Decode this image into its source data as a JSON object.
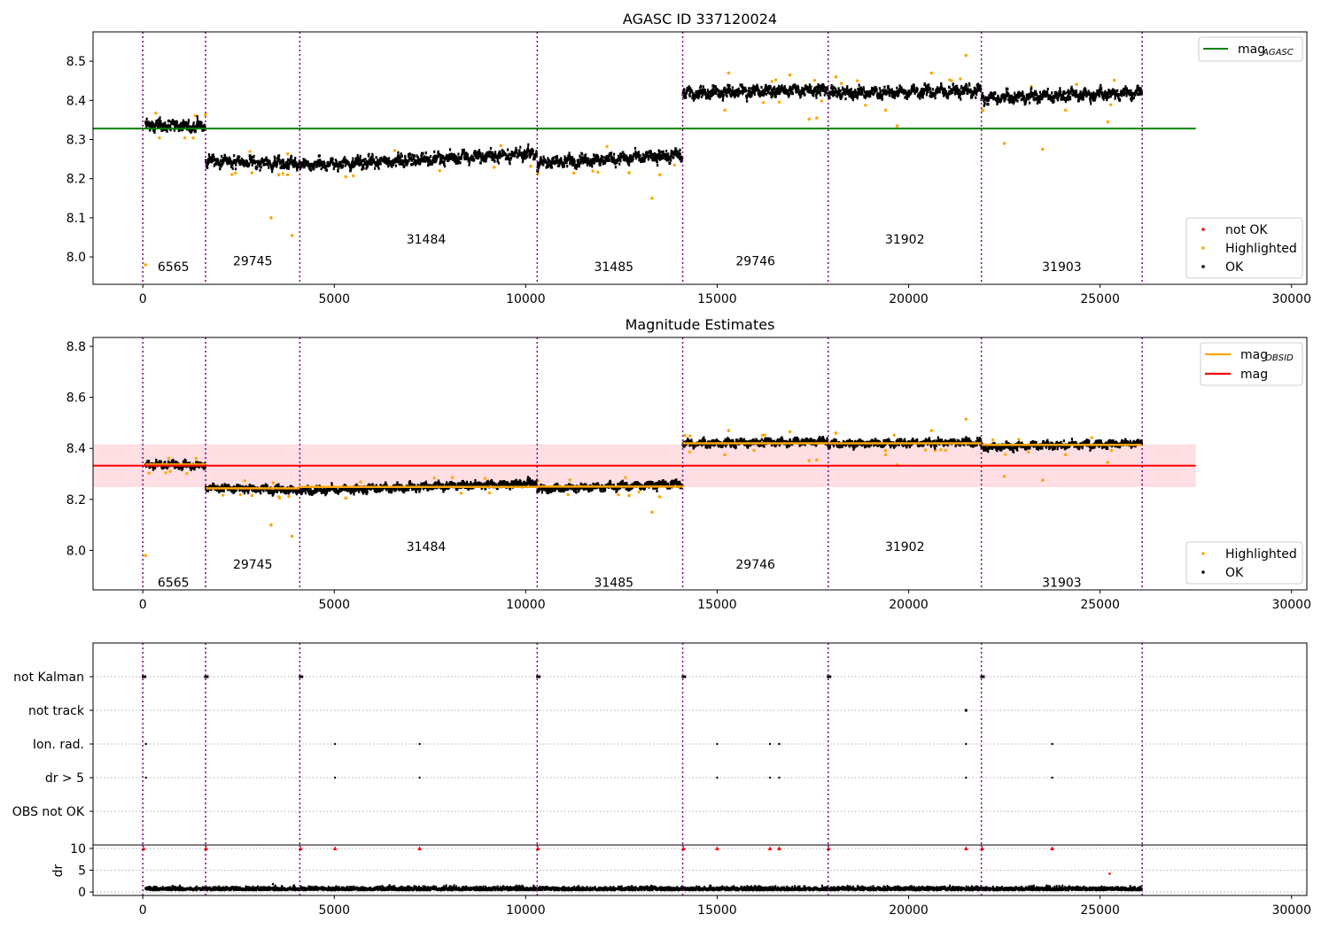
{
  "title_top": "AGASC ID 337120024",
  "title_mid": "Magnitude Estimates",
  "colors": {
    "ok": "#000000",
    "highlighted": "#ffa500",
    "not_ok": "#ff0000",
    "obs_line": "#800080",
    "agasc_line": "#008000",
    "mag_line": "#ff0000",
    "obs_mag_line": "#ffa500",
    "mag_band": "#ffdfe3",
    "grid": "#b0b0b0"
  },
  "chart_data": [
    {
      "type": "scatter",
      "title": "AGASC ID 337120024",
      "xlim": [
        -1300,
        30400
      ],
      "ylim": [
        7.93,
        8.575
      ],
      "xticks": [
        0,
        5000,
        10000,
        15000,
        20000,
        25000,
        30000
      ],
      "yticks": [
        8.0,
        8.1,
        8.2,
        8.3,
        8.4,
        8.5
      ],
      "obs_boundaries": [
        0,
        1640,
        4100,
        10300,
        14100,
        17900,
        21900,
        26100
      ],
      "obs_labels": [
        {
          "name": "6565",
          "x": 800,
          "y": 7.975
        },
        {
          "name": "29745",
          "x": 2870,
          "y": 7.99
        },
        {
          "name": "31484",
          "x": 7400,
          "y": 8.045
        },
        {
          "name": "31485",
          "x": 12300,
          "y": 7.975
        },
        {
          "name": "29746",
          "x": 16000,
          "y": 7.99
        },
        {
          "name": "31902",
          "x": 19900,
          "y": 8.045
        },
        {
          "name": "31903",
          "x": 24000,
          "y": 7.975
        }
      ],
      "segments": [
        {
          "x": [
            70,
            1640
          ],
          "mean": 8.337,
          "trend": [
            8.337,
            8.333
          ]
        },
        {
          "x": [
            1640,
            4100
          ],
          "mean": 8.243,
          "trend": [
            8.246,
            8.237
          ]
        },
        {
          "x": [
            4100,
            10300
          ],
          "mean": 8.249,
          "trend": [
            8.233,
            8.264
          ]
        },
        {
          "x": [
            10300,
            14100
          ],
          "mean": 8.25,
          "trend": [
            8.24,
            8.26
          ]
        },
        {
          "x": [
            14100,
            17900
          ],
          "mean": 8.42,
          "trend": [
            8.418,
            8.428
          ]
        },
        {
          "x": [
            17900,
            21900
          ],
          "mean": 8.42,
          "trend": [
            8.418,
            8.425
          ]
        },
        {
          "x": [
            21900,
            26100
          ],
          "mean": 8.414,
          "trend": [
            8.405,
            8.42
          ]
        }
      ],
      "highlighted_points": [
        [
          70,
          7.98
        ],
        [
          3350,
          8.1
        ],
        [
          3900,
          8.055
        ],
        [
          3550,
          8.21
        ],
        [
          2850,
          8.215
        ],
        [
          5300,
          8.205
        ],
        [
          13300,
          8.15
        ],
        [
          12700,
          8.215
        ],
        [
          13500,
          8.21
        ],
        [
          17400,
          8.352
        ],
        [
          17600,
          8.355
        ],
        [
          19400,
          8.375
        ],
        [
          19700,
          8.335
        ],
        [
          15200,
          8.375
        ],
        [
          21500,
          8.515
        ],
        [
          20600,
          8.47
        ],
        [
          22500,
          8.29
        ],
        [
          23500,
          8.275
        ],
        [
          25200,
          8.345
        ],
        [
          15300,
          8.47
        ],
        [
          16900,
          8.465
        ],
        [
          18100,
          8.46
        ],
        [
          24100,
          8.375
        ]
      ],
      "agasc_mag": 8.328,
      "agasc_x_range": [
        -1300,
        27500
      ],
      "legend": {
        "line": "mag",
        "line_subscript": "AGASC",
        "markers": [
          "not OK",
          "Highlighted",
          "OK"
        ]
      }
    },
    {
      "type": "scatter",
      "title": "Magnitude Estimates",
      "xlim": [
        -1300,
        30400
      ],
      "ylim": [
        7.845,
        8.835
      ],
      "xticks": [
        0,
        5000,
        10000,
        15000,
        20000,
        25000,
        30000
      ],
      "yticks": [
        8.0,
        8.2,
        8.4,
        8.6,
        8.8
      ],
      "obs_labels": [
        {
          "name": "6565",
          "x": 800,
          "y": 7.875
        },
        {
          "name": "29745",
          "x": 2870,
          "y": 7.945
        },
        {
          "name": "31484",
          "x": 7400,
          "y": 8.015
        },
        {
          "name": "31485",
          "x": 12300,
          "y": 7.875
        },
        {
          "name": "29746",
          "x": 16000,
          "y": 7.945
        },
        {
          "name": "31902",
          "x": 19900,
          "y": 8.015
        },
        {
          "name": "31903",
          "x": 24000,
          "y": 7.875
        }
      ],
      "mag": 8.332,
      "mag_band": [
        8.248,
        8.416
      ],
      "mag_x_range": [
        -1300,
        27500
      ],
      "legend": {
        "lines": [
          {
            "name": "mag",
            "subscript": "OBSID",
            "color": "#ffa500"
          },
          {
            "name": "mag",
            "subscript": "",
            "color": "#ff0000"
          }
        ],
        "markers": [
          "Highlighted",
          "OK"
        ]
      }
    },
    {
      "type": "scatter",
      "title": "",
      "xlim": [
        -1300,
        30400
      ],
      "flag_rows": [
        "not Kalman",
        "not track",
        "Ion. rad.",
        "dr > 5",
        "OBS not OK"
      ],
      "flags": {
        "not Kalman": [
          20,
          1650,
          4120,
          10320,
          14120,
          17910,
          21920
        ],
        "not track": [
          21510
        ],
        "Ion. rad.": [
          80,
          5020,
          7230,
          15000,
          16380,
          16620,
          21500,
          23750
        ],
        "dr > 5": [
          80,
          5020,
          7230,
          15000,
          16380,
          16620,
          21500,
          23750
        ],
        "OBS not OK": []
      }
    },
    {
      "type": "scatter",
      "title": "",
      "ylabel": "dr",
      "xlim": [
        -1300,
        30400
      ],
      "ylim": [
        -0.8,
        10.8
      ],
      "xticks": [
        0,
        5000,
        10000,
        15000,
        20000,
        25000,
        30000
      ],
      "yticks": [
        0,
        5,
        10
      ],
      "clipped_points_x": [
        20,
        1650,
        4120,
        5020,
        7230,
        10320,
        14120,
        15000,
        16380,
        16620,
        17910,
        21500,
        21920,
        23750
      ],
      "outlier_points": [
        [
          25250,
          4.2
        ],
        [
          3400,
          1.8
        ],
        [
          3950,
          1.5
        ]
      ]
    }
  ]
}
